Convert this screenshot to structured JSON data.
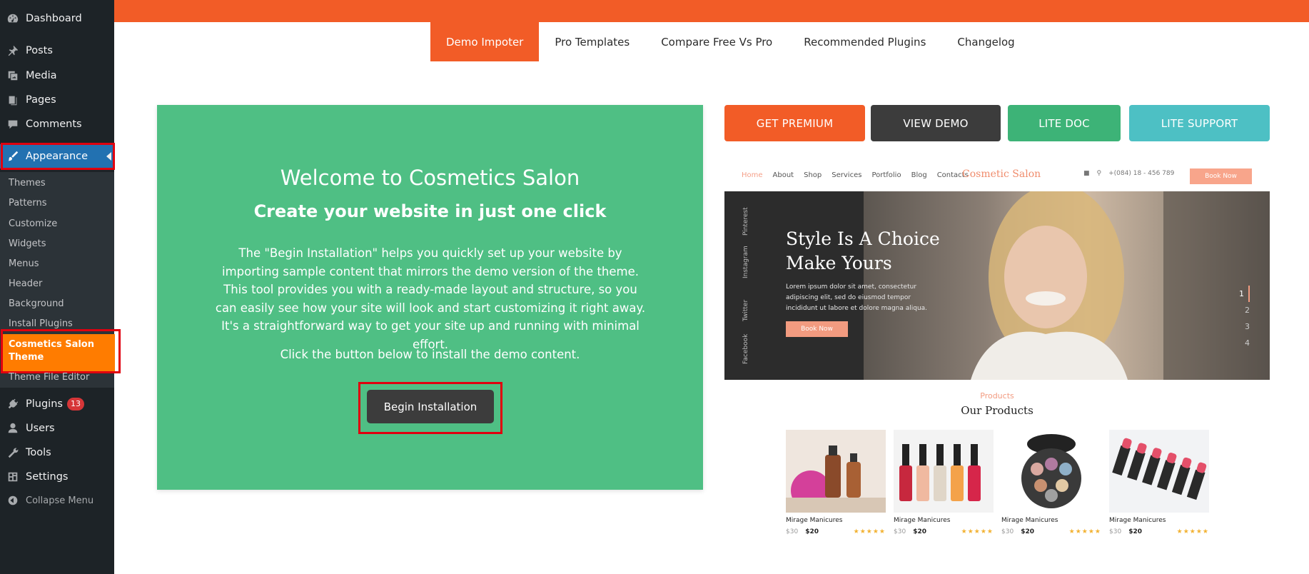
{
  "sidebar": {
    "dashboard": "Dashboard",
    "posts": "Posts",
    "media": "Media",
    "pages": "Pages",
    "comments": "Comments",
    "appearance": "Appearance",
    "submenu": {
      "themes": "Themes",
      "patterns": "Patterns",
      "customize": "Customize",
      "widgets": "Widgets",
      "menus": "Menus",
      "header": "Header",
      "background": "Background",
      "install_plugins": "Install Plugins",
      "current": "Cosmetics Salon Theme",
      "theme_file_editor": "Theme File Editor"
    },
    "plugins": "Plugins",
    "plugins_badge": "13",
    "users": "Users",
    "tools": "Tools",
    "settings": "Settings",
    "collapse": "Collapse Menu"
  },
  "tabs": [
    "Demo Impoter",
    "Pro Templates",
    "Compare Free Vs Pro",
    "Recommended Plugins",
    "Changelog"
  ],
  "welcome": {
    "title": "Welcome to Cosmetics Salon",
    "subtitle": "Create your website in just one click",
    "body": "The \"Begin Installation\" helps you quickly set up your website by importing sample content that mirrors the demo version of the theme. This tool provides you with a ready-made layout and structure, so you can easily see how your site will look and start customizing it right away. It's a straightforward way to get your site up and running with minimal effort.",
    "note": "Click the button below to install the demo content.",
    "button": "Begin Installation"
  },
  "actions": {
    "premium": "GET PREMIUM",
    "demo": "VIEW DEMO",
    "doc": "LITE DOC",
    "support": "LITE SUPPORT"
  },
  "colors": {
    "orange": "#f25c27",
    "green": "#4fbf84",
    "dark": "#3c3c3c",
    "teal": "#4dc0c4",
    "wp_blue": "#2271b1",
    "highlight_red": "#e0000f"
  },
  "preview": {
    "nav": [
      "Home",
      "About",
      "Shop",
      "Services",
      "Portfolio",
      "Blog",
      "Contacts"
    ],
    "logo": "Cosmetic Salon",
    "phone": "+(084) 18 - 456 789",
    "book": "Book Now",
    "social": [
      "Pinterest",
      "Instagram",
      "Twitter",
      "Facebook"
    ],
    "hero_title_1": "Style Is A Choice",
    "hero_title_2": "Make Yours",
    "hero_text": "Lorem ipsum dolor sit amet, consectetur adipiscing elit, sed do eiusmod tempor incididunt ut labore et dolore magna aliqua.",
    "hero_button": "Book Now",
    "pager": [
      "1",
      "2",
      "3",
      "4"
    ],
    "kicker": "Products",
    "heading": "Our Products",
    "products": [
      {
        "name": "Mirage Manicures",
        "old": "$30",
        "new": "$20",
        "stars": "★★★★★"
      },
      {
        "name": "Mirage Manicures",
        "old": "$30",
        "new": "$20",
        "stars": "★★★★★"
      },
      {
        "name": "Mirage Manicures",
        "old": "$30",
        "new": "$20",
        "stars": "★★★★★"
      },
      {
        "name": "Mirage Manicures",
        "old": "$30",
        "new": "$20",
        "stars": "★★★★★"
      }
    ]
  }
}
